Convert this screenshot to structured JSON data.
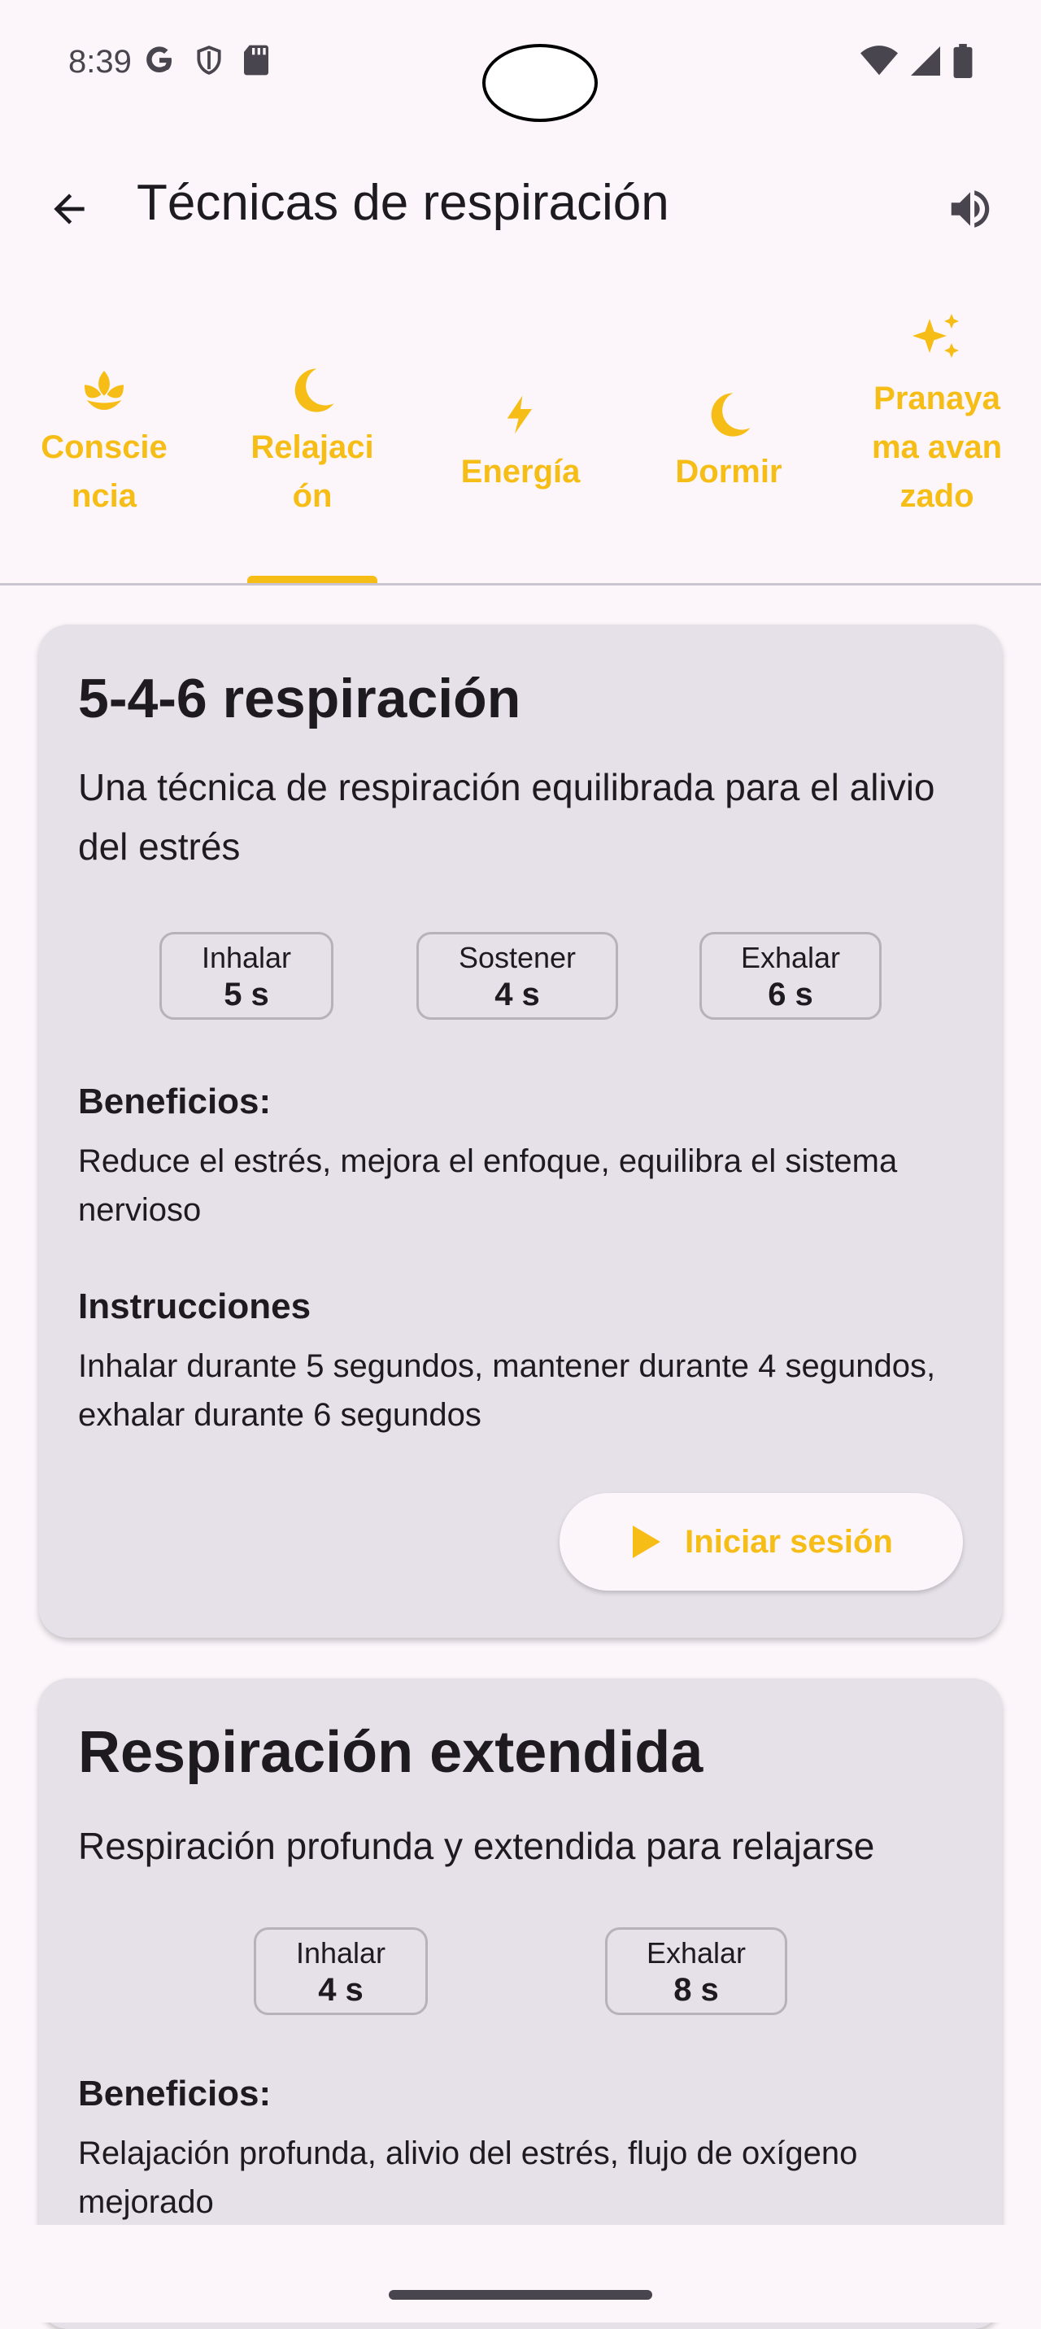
{
  "status": {
    "time": "8:39"
  },
  "header": {
    "title": "Técnicas de respiración"
  },
  "tabs": [
    {
      "label": "Consciencia",
      "icon": "lotus-icon"
    },
    {
      "label": "Relajación",
      "icon": "moon-icon",
      "selected": true
    },
    {
      "label": "Energía",
      "icon": "bolt-icon"
    },
    {
      "label": "Dormir",
      "icon": "moon-icon"
    },
    {
      "label": "Pranayama avanzado",
      "icon": "sparkles-icon"
    }
  ],
  "cards": [
    {
      "title": "5-4-6 respiración",
      "description": "Una técnica de respiración equilibrada para el alivio del estrés",
      "phases": [
        {
          "name": "Inhalar",
          "value": "5 s"
        },
        {
          "name": "Sostener",
          "value": "4 s"
        },
        {
          "name": "Exhalar",
          "value": "6 s"
        }
      ],
      "benefits_title": "Beneficios:",
      "benefits": "Reduce el estrés, mejora el enfoque, equilibra el sistema nervioso",
      "instructions_title": "Instrucciones",
      "instructions": "Inhalar durante 5 segundos, mantener durante 4 segundos, exhalar durante 6 segundos",
      "start_label": "Iniciar sesión"
    },
    {
      "title": "Respiración extendida",
      "description": "Respiración profunda y extendida para relajarse",
      "phases": [
        {
          "name": "Inhalar",
          "value": "4 s"
        },
        {
          "name": "Exhalar",
          "value": "8 s"
        }
      ],
      "benefits_title": "Beneficios:",
      "benefits": "Relajación profunda, alivio del estrés, flujo de oxígeno mejorado"
    }
  ],
  "colors": {
    "accent": "#f6bd16",
    "card": "#e6e0e9",
    "background": "#fcf6fb"
  }
}
